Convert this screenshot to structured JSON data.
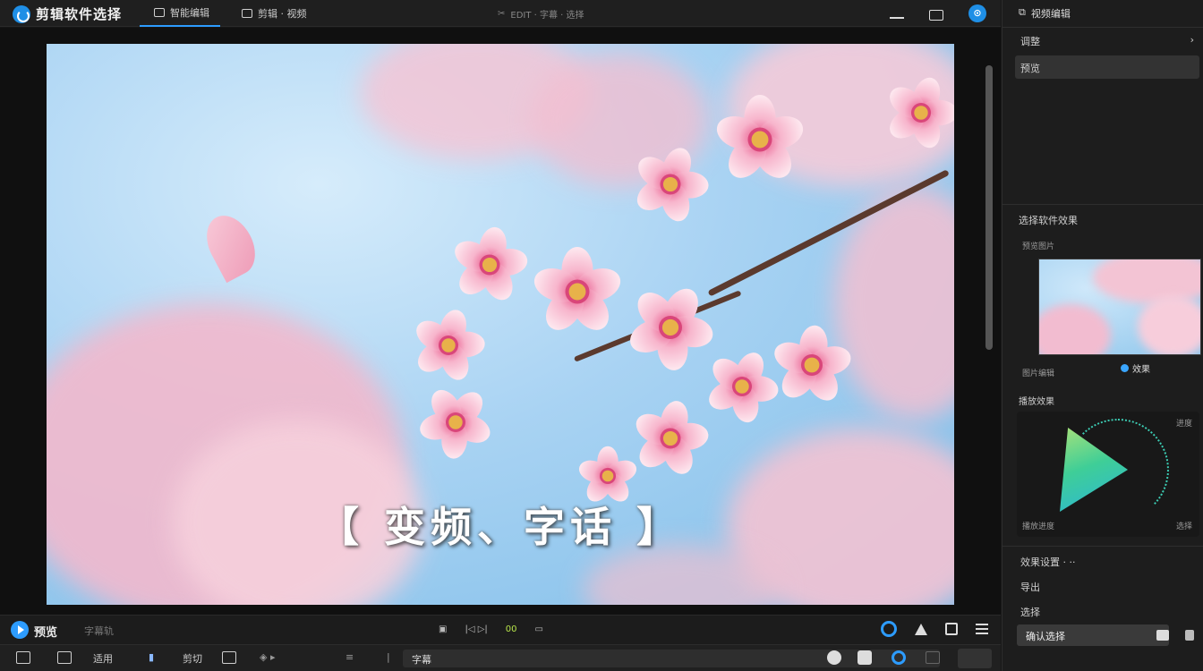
{
  "app": {
    "title": "剪辑软件选择"
  },
  "topbar": {
    "tabs": [
      {
        "label": "智能编辑"
      },
      {
        "label": "剪辑 · 视频"
      }
    ],
    "center_title": "EDIT · 字幕 · 选择"
  },
  "preview": {
    "subtitle": "【 变频、字话 】"
  },
  "playbar": {
    "label": "预览",
    "sub_label": "字幕轨",
    "center": [
      "▣",
      "|◁ ▷|",
      "00",
      "▭"
    ]
  },
  "toolbar": {
    "items": [
      "适用",
      "剪切",
      "字幕"
    ]
  },
  "right_panel": {
    "header": "视频编辑",
    "menu": [
      {
        "label": "调整",
        "arrow": "›"
      },
      {
        "label": "预览"
      }
    ],
    "section_title": "选择软件效果",
    "thumb_caption": "预览图片",
    "thumb_label": "效果",
    "thumb_foot": "图片编辑",
    "viz_title": "播放效果",
    "viz_top_right": "进度",
    "viz_bottom_left": "播放进度",
    "viz_bottom_right": "选择",
    "rows": [
      {
        "label": "效果设置 · ··"
      },
      {
        "label": "导出"
      },
      {
        "label": "选择"
      }
    ],
    "action_label": "确认选择"
  },
  "colors": {
    "accent": "#2d9cff",
    "sky": "#8ec6ec",
    "petal": "#f7b5cc",
    "gradient_green": "#3fce97"
  }
}
